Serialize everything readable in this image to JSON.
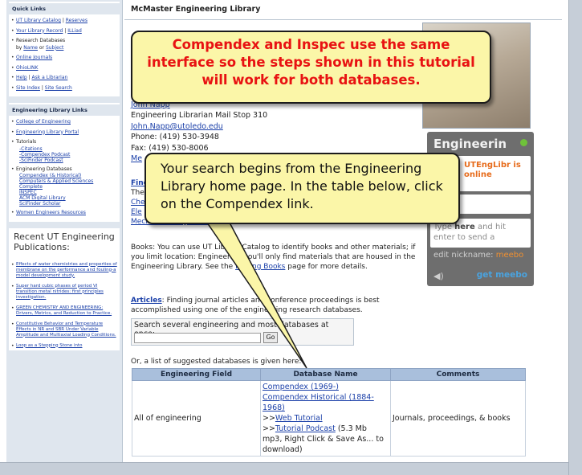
{
  "sidebar": {
    "quick_links_heading": "Quick Links",
    "quick_links": [
      {
        "parts": [
          "UT Library Catalog",
          " | ",
          "Reserves"
        ]
      },
      {
        "parts": [
          "Your Library Record",
          " | ",
          "ILLiad"
        ]
      },
      {
        "parts": [
          "Research Databases",
          " by ",
          "Name",
          " or ",
          "Subject"
        ]
      },
      {
        "parts": [
          "Online Journals"
        ]
      },
      {
        "parts": [
          "OhioLINK"
        ]
      },
      {
        "parts": [
          "Help",
          " | ",
          "Ask a Librarian"
        ]
      },
      {
        "parts": [
          "Site Index",
          " | ",
          "Site Search"
        ]
      }
    ],
    "eng_links_heading": "Engineering Library Links",
    "eng_links": [
      "College of Engineering",
      "Engineering Library Portal"
    ],
    "tutorials_label": "Tutorials",
    "tutorial_items": [
      "-Citations",
      "-Compendex Podcast",
      "-SciFinder Podcast"
    ],
    "eng_db_label": "Engineering Databases",
    "eng_db_items": [
      "Compendex (& Historical)",
      "Computers & Applied Sciences",
      "Complete",
      "INSPEC",
      "ACM Digital Library",
      "SciFinder Scholar"
    ],
    "women_link": "Women Engineers Resources",
    "recent_title": "Recent UT Engineering Publications:",
    "recent_items": [
      "Effects of water chemistries and properties of membrane on the performance and fouling-a model development study.",
      "Super hard cubic phases of period VI transition metal nitrides: first principles investigation.",
      "GREEN CHEMISTRY AND ENGINEERING: Drivers, Metrics, and Reduction to Practice.",
      "Constitutive Behavior and Temperature Effects in NR and SBR Under Variable Amplitude and Multiaxial Loading Conditions.",
      "Loop as a Stepping Stone into"
    ]
  },
  "main": {
    "library_title": "McMaster Engineering Library",
    "contact": {
      "name": "John Napp",
      "title": "Engineering Librarian Mail Stop 310",
      "email": "John.Napp@utoledo.edu",
      "phone": "Phone: (419) 530-3948",
      "fax": "Fax: (419) 530-8006",
      "partial": "Me"
    },
    "find_partial": "Find",
    "the_partial": "The",
    "che_partial": "Che",
    "ele_partial": "Ele",
    "mech_partial": "Mechanical Engineering",
    "books_text_1": "Books:  You can use",
    "books_text_2": "UT Library Catalog to identify books and other materials; if you limit location: Engineering you'll only find materials that are housed in the Engineering Library.  See the",
    "books_link": "Finding Books",
    "books_text_3": "page for more details.",
    "articles_label": "Articles",
    "articles_text": ": Finding journal articles and conference proceedings is best accomplished using one of the engineering research databases.",
    "search_label": "Search several engineering and most databases at once:",
    "search_go": "Go",
    "list_intro": "Or, a list of suggested databases is given here:",
    "table": {
      "headers": [
        "Engineering Field",
        "Database Name",
        "Comments"
      ],
      "row_field": "All of engineering",
      "row_links": [
        "Compendex (1969-)",
        "Compendex Historical (1884-1968)"
      ],
      "web_prefix": ">>",
      "web_tutorial": "Web Tutorial",
      "podcast_prefix": ">>",
      "podcast_link": "Tutorial Podcast",
      "podcast_note": " (5.3 Mb mp3, Right Click & Save As... to download)",
      "row_comment": "Journals, proceedings, & books"
    }
  },
  "meebo": {
    "title": "Engineerin",
    "status": "UTEngLibr is online",
    "input_hint_1": "Type ",
    "input_hint_bold": "here",
    "input_hint_2": " and hit enter to send a",
    "nickname_label": "edit nickname: ",
    "nickname_value": "meebo",
    "brand": "get meebo"
  },
  "callouts": {
    "top": "Compendex and Inspec use the same interface so the steps shown in this tutorial will work for both databases.",
    "middle": "Your search begins from the Engineering Library home page. In the table below, click on the Compendex link."
  },
  "colors": {
    "callout_bg": "#fbf6a8",
    "callout_top_text": "#e81212",
    "link": "#1a3fa8",
    "table_header": "#a9bfdc"
  }
}
